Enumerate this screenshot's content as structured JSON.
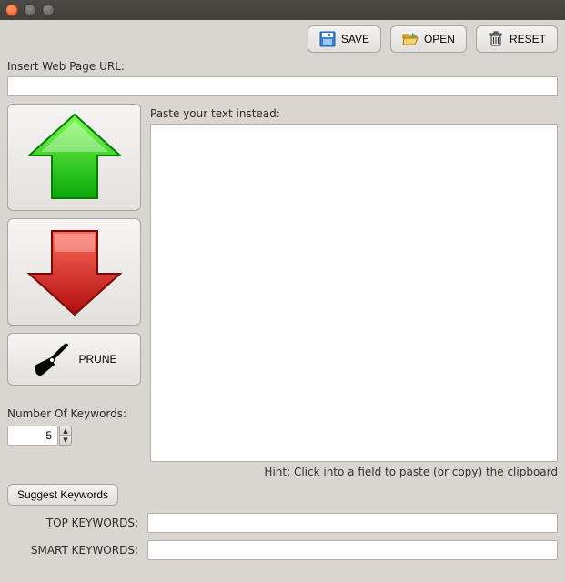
{
  "toolbar": {
    "save_label": "SAVE",
    "open_label": "OPEN",
    "reset_label": "RESET"
  },
  "url": {
    "label": "Insert Web Page URL:",
    "value": ""
  },
  "paste": {
    "label": "Paste your text instead:",
    "value": ""
  },
  "prune": {
    "label": "PRUNE"
  },
  "keywords": {
    "count_label": "Number Of Keywords:",
    "count_value": "5",
    "suggest_label": "Suggest Keywords",
    "top_label": "TOP KEYWORDS:",
    "top_value": "",
    "smart_label": "SMART KEYWORDS:",
    "smart_value": ""
  },
  "hint": "Hint: Click into a field to paste (or copy) the clipboard"
}
